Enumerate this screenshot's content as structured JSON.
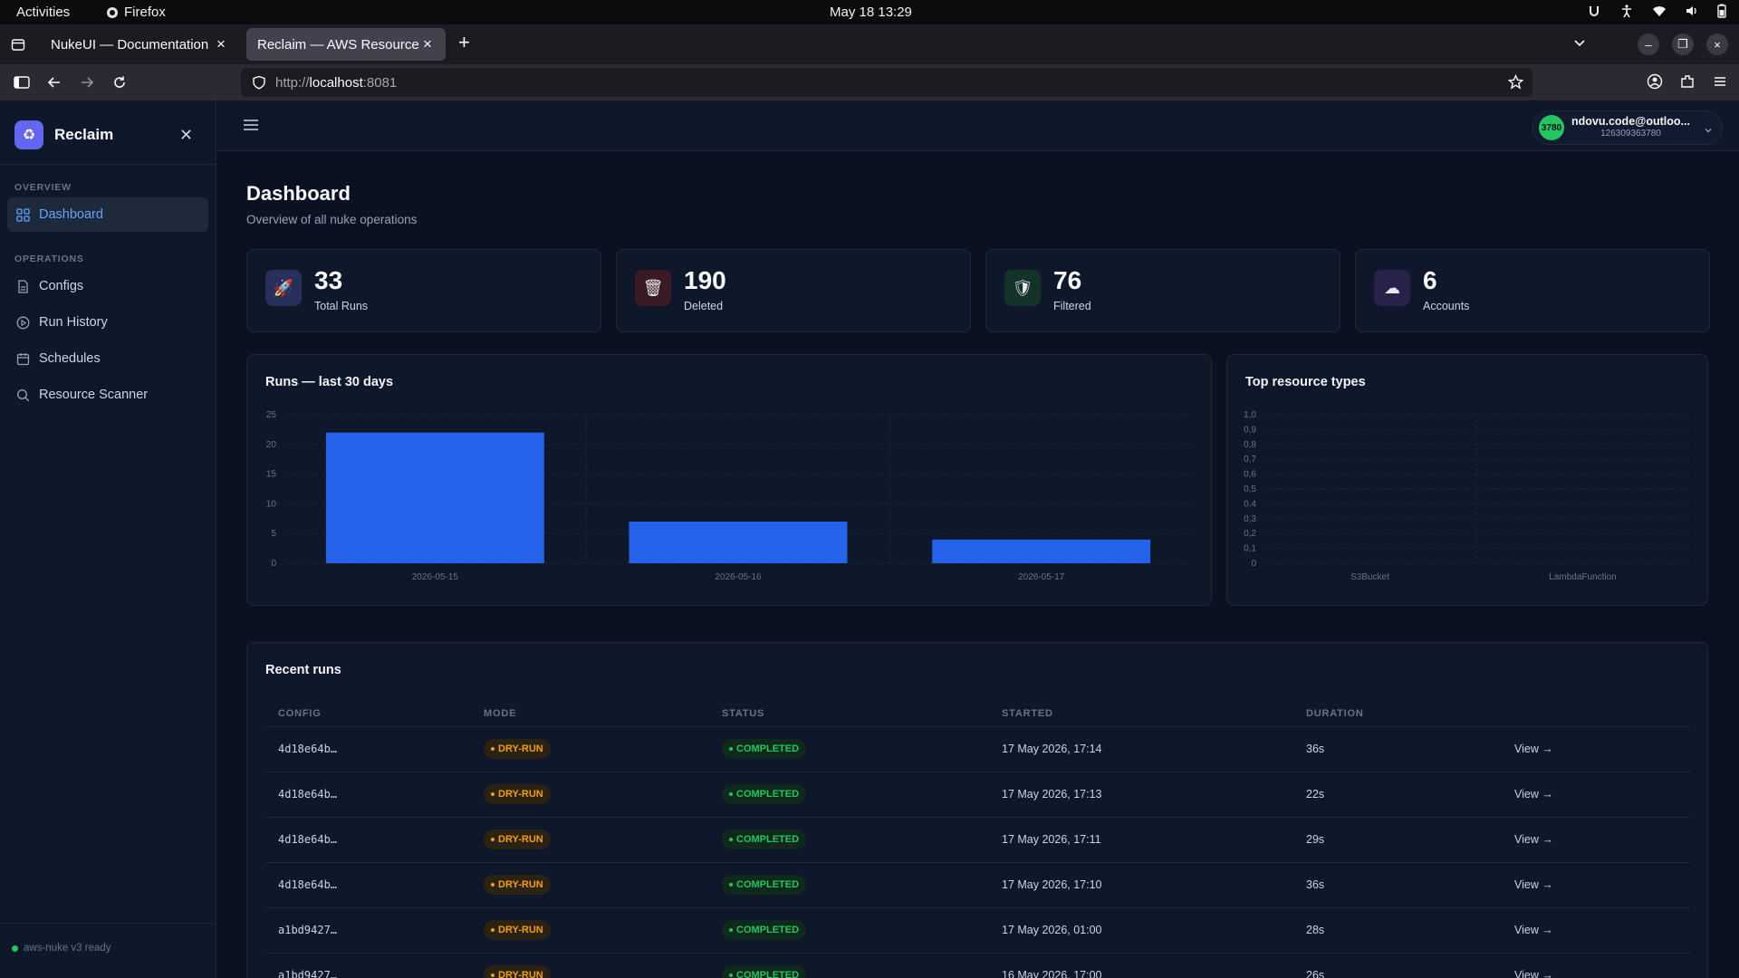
{
  "system": {
    "activities": "Activities",
    "app_name": "Firefox",
    "clock": "May 18  13:29"
  },
  "browser": {
    "tabs": [
      {
        "label": "NukeUI — Documentation"
      },
      {
        "label": "Reclaim — AWS Resource Cl"
      }
    ],
    "url_scheme": "http://",
    "url_host": "localhost",
    "url_port": ":8081"
  },
  "app": {
    "brand": "Reclaim",
    "sections": {
      "overview": "OVERVIEW",
      "operations": "OPERATIONS"
    },
    "nav": {
      "dashboard": "Dashboard",
      "configs": "Configs",
      "run_history": "Run History",
      "schedules": "Schedules",
      "resource_scanner": "Resource Scanner"
    },
    "status": "aws-nuke v3 ready"
  },
  "account": {
    "avatar_text": "3780",
    "email": "ndovu.code@outloo...",
    "account_id": "126309363780"
  },
  "page": {
    "title": "Dashboard",
    "subtitle": "Overview of all nuke operations"
  },
  "stats": [
    {
      "value": "33",
      "label": "Total Runs",
      "icon": "rocket-icon",
      "color": "#3b4a7a"
    },
    {
      "value": "190",
      "label": "Deleted",
      "icon": "trash-icon",
      "color": "#4a1f2a"
    },
    {
      "value": "76",
      "label": "Filtered",
      "icon": "shield-icon",
      "color": "#14352a"
    },
    {
      "value": "6",
      "label": "Accounts",
      "icon": "cloud-icon",
      "color": "#2e2550"
    }
  ],
  "runs_chart_title": "Runs — last 30 days",
  "resource_chart_title": "Top resource types",
  "chart_data": [
    {
      "type": "bar",
      "title": "Runs — last 30 days",
      "categories": [
        "2026-05-15",
        "2026-05-16",
        "2026-05-17"
      ],
      "values": [
        22,
        7,
        4
      ],
      "ylim": [
        0,
        25
      ],
      "yticks": [
        "0",
        "5",
        "10",
        "15",
        "20",
        "25"
      ],
      "color": "#2563eb",
      "grid": true
    },
    {
      "type": "bar",
      "title": "Top resource types",
      "categories": [
        "S3Bucket",
        "LambdaFunction"
      ],
      "values": [
        0,
        0
      ],
      "ylim": [
        0,
        1
      ],
      "yticks": [
        "0",
        "0,1",
        "0,2",
        "0,3",
        "0,4",
        "0,5",
        "0,6",
        "0,7",
        "0,8",
        "0,9",
        "1,0"
      ],
      "color": "#2563eb",
      "grid": true
    }
  ],
  "recent_runs": {
    "title": "Recent runs",
    "columns": [
      "CONFIG",
      "MODE",
      "STATUS",
      "STARTED",
      "DURATION"
    ],
    "rows": [
      {
        "config": "4d18e64b…",
        "mode": "DRY-RUN",
        "status": "COMPLETED",
        "started": "17 May 2026, 17:14",
        "duration": "36s",
        "action": "View →"
      },
      {
        "config": "4d18e64b…",
        "mode": "DRY-RUN",
        "status": "COMPLETED",
        "started": "17 May 2026, 17:13",
        "duration": "22s",
        "action": "View →"
      },
      {
        "config": "4d18e64b…",
        "mode": "DRY-RUN",
        "status": "COMPLETED",
        "started": "17 May 2026, 17:11",
        "duration": "29s",
        "action": "View →"
      },
      {
        "config": "4d18e64b…",
        "mode": "DRY-RUN",
        "status": "COMPLETED",
        "started": "17 May 2026, 17:10",
        "duration": "36s",
        "action": "View →"
      },
      {
        "config": "a1bd9427…",
        "mode": "DRY-RUN",
        "status": "COMPLETED",
        "started": "17 May 2026, 01:00",
        "duration": "28s",
        "action": "View →"
      },
      {
        "config": "a1bd9427…",
        "mode": "DRY-RUN",
        "status": "COMPLETED",
        "started": "16 May 2026, 17:00",
        "duration": "26s",
        "action": "View →"
      }
    ]
  }
}
